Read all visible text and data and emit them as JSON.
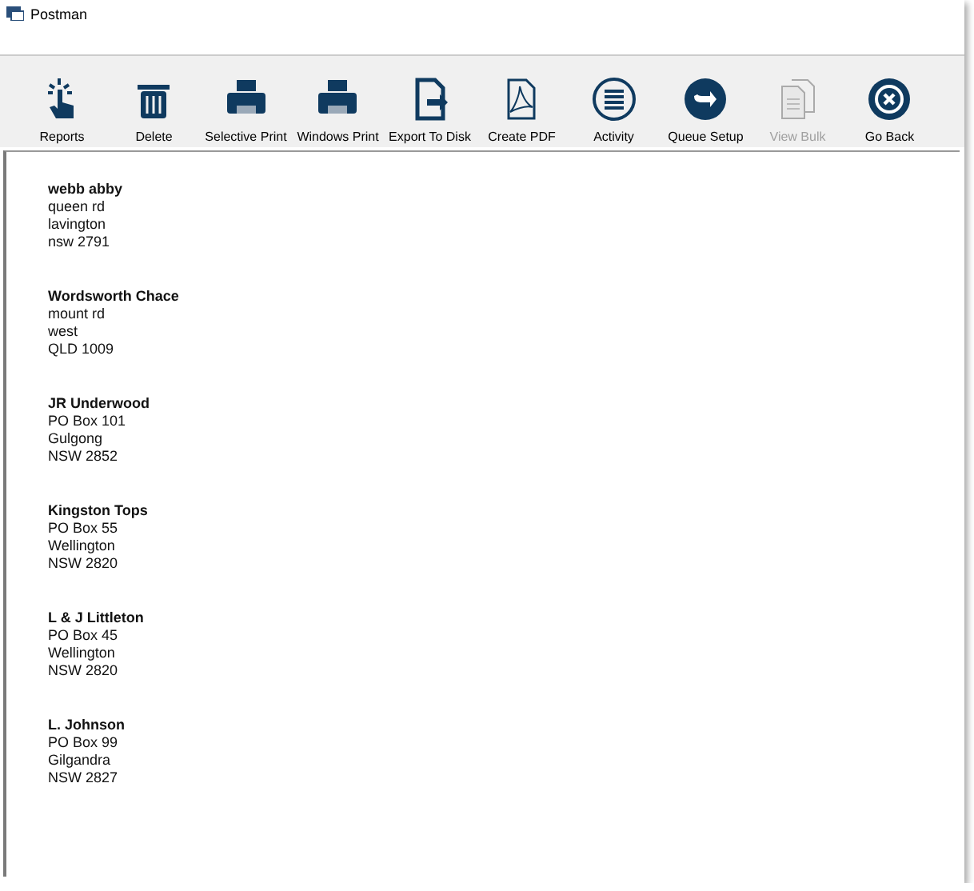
{
  "window": {
    "title": "Postman"
  },
  "toolbar": [
    {
      "label": "Reports",
      "kind": "touch",
      "disabled": false
    },
    {
      "label": "Delete",
      "kind": "trash",
      "disabled": false
    },
    {
      "label": "Selective Print",
      "kind": "printer",
      "disabled": false
    },
    {
      "label": "Windows Print",
      "kind": "printer",
      "disabled": false
    },
    {
      "label": "Export To Disk",
      "kind": "export",
      "disabled": false
    },
    {
      "label": "Create PDF",
      "kind": "pdf",
      "disabled": false
    },
    {
      "label": "Activity",
      "kind": "list",
      "disabled": false
    },
    {
      "label": "Queue Setup",
      "kind": "arrow",
      "disabled": false
    },
    {
      "label": "View Bulk",
      "kind": "docs",
      "disabled": true
    },
    {
      "label": "Go Back",
      "kind": "close",
      "disabled": false
    }
  ],
  "addresses": [
    {
      "name": "webb abby",
      "lines": [
        "queen rd",
        "lavington",
        "nsw 2791"
      ]
    },
    {
      "name": "Wordsworth Chace",
      "lines": [
        "mount rd",
        "west",
        "QLD 1009"
      ]
    },
    {
      "name": "JR Underwood",
      "lines": [
        "PO Box 101",
        "Gulgong",
        "NSW 2852"
      ]
    },
    {
      "name": "Kingston Tops",
      "lines": [
        "PO Box 55",
        "Wellington",
        "NSW 2820"
      ]
    },
    {
      "name": "L & J Littleton",
      "lines": [
        "PO Box 45",
        "Wellington",
        "NSW 2820"
      ]
    },
    {
      "name": "L. Johnson",
      "lines": [
        "PO Box 99",
        "Gilgandra",
        "NSW 2827"
      ]
    }
  ]
}
